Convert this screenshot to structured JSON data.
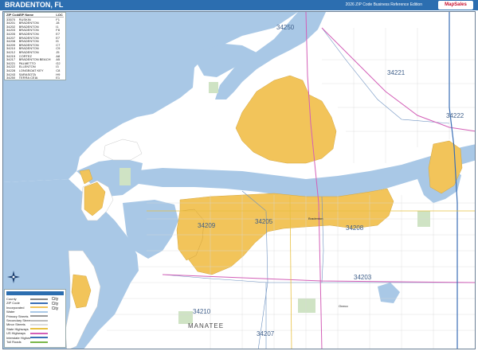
{
  "header": {
    "title": "BRADENTON, FL",
    "edition": "2026 ZIP Code Business Reference Edition",
    "logo_text": "MapSales"
  },
  "zip_table": {
    "headers": [
      "ZIP Code",
      "ZIP Name",
      "LOC"
    ],
    "rows": [
      [
        "33570",
        "RUSKIN",
        "F1"
      ],
      [
        "34201",
        "BRADENTON",
        "J8"
      ],
      [
        "34202",
        "BRADENTON",
        "I1"
      ],
      [
        "34203",
        "BRADENTON",
        "F8"
      ],
      [
        "34205",
        "BRADENTON",
        "E7"
      ],
      [
        "34207",
        "BRADENTON",
        "E7"
      ],
      [
        "34208",
        "BRADENTON",
        "I5"
      ],
      [
        "34209",
        "BRADENTON",
        "C7"
      ],
      [
        "34210",
        "BRADENTON",
        "C9"
      ],
      [
        "34212",
        "BRADENTON",
        "J5"
      ],
      [
        "34215",
        "CORTEZ",
        "A8"
      ],
      [
        "34217",
        "BRADENTON BEACH",
        "A5"
      ],
      [
        "34221",
        "PALMETTO",
        "G2"
      ],
      [
        "34222",
        "ELLENTON",
        "I3"
      ],
      [
        "34228",
        "LONGBOAT KEY",
        "C8"
      ],
      [
        "34243",
        "SARASOTA",
        "H9"
      ],
      [
        "34250",
        "TERRA CEIA",
        "E1"
      ]
    ]
  },
  "legend": {
    "items": [
      {
        "label": "County",
        "color": "#8a8a8a"
      },
      {
        "label": "ZIP Code",
        "color": "#3b6fb6"
      },
      {
        "label": "Incorporated",
        "color": "#f2c45a"
      },
      {
        "label": "Water",
        "color": "#a9c8e6"
      },
      {
        "label": "Primary Streets",
        "color": "#999999"
      },
      {
        "label": "Secondary Streets",
        "color": "#bbbbbb"
      },
      {
        "label": "Minor Streets",
        "color": "#dddddd"
      },
      {
        "label": "State Highways",
        "color": "#e8c040"
      },
      {
        "label": "US Highways",
        "color": "#d35fb7"
      },
      {
        "label": "Interstate Highways",
        "color": "#3b6fb6"
      },
      {
        "label": "Toll Roads",
        "color": "#7ab648"
      }
    ],
    "city_sample": [
      "City",
      "City",
      "City"
    ]
  },
  "zip_labels": [
    {
      "name": "zip-34250",
      "text": "34250"
    },
    {
      "name": "zip-34221",
      "text": "34221"
    },
    {
      "name": "zip-34222",
      "text": "34222"
    },
    {
      "name": "zip-34205",
      "text": "34205"
    },
    {
      "name": "zip-34209",
      "text": "34209"
    },
    {
      "name": "zip-34208",
      "text": "34208"
    },
    {
      "name": "zip-34203",
      "text": "34203"
    },
    {
      "name": "zip-34210",
      "text": "34210"
    },
    {
      "name": "zip-34207",
      "text": "34207"
    }
  ],
  "place_labels": [
    {
      "name": "place-manatee",
      "text": "MANATEE"
    },
    {
      "name": "place-bradenton",
      "text": "Bradenton"
    },
    {
      "name": "place-oneco",
      "text": "Oneco"
    }
  ],
  "colors": {
    "water": "#a9c8e6",
    "land": "#ffffff",
    "incorporated": "#f2c45a",
    "park": "#cfe3c4",
    "highway_us": "#d35fb7",
    "interstate": "#3b6fb6",
    "zip_label": "#3f5f8a"
  }
}
